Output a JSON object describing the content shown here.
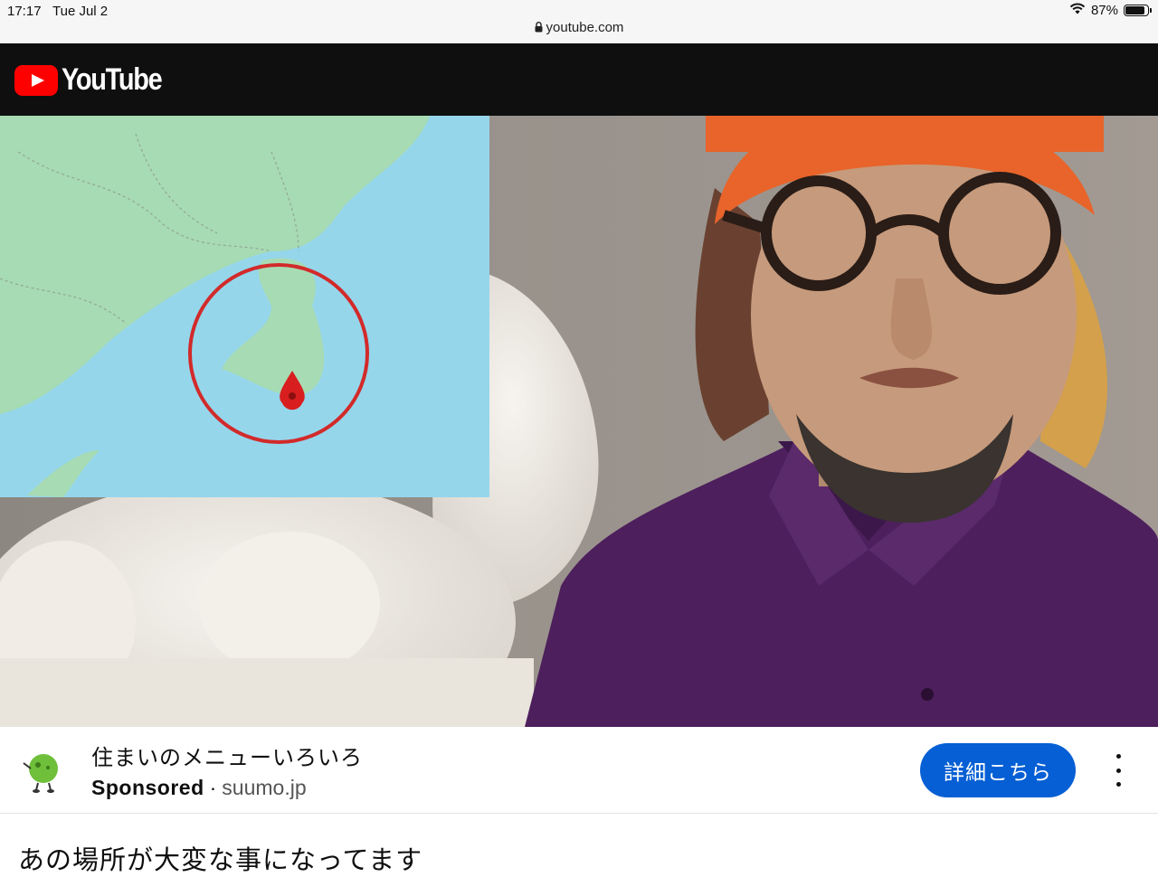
{
  "status_bar": {
    "time": "17:17",
    "date": "Tue Jul 2",
    "battery_percent": "87%",
    "battery_level": 0.87,
    "url": "youtube.com",
    "icons": [
      "wifi-icon",
      "battery-icon",
      "lock-icon"
    ]
  },
  "header": {
    "logo_text": "YouTube",
    "brand_color": "#ff0000",
    "background": "#0f0f0f"
  },
  "video": {
    "map_overlay": {
      "marker_color": "#d81e1e",
      "circle_color": "#d22a2a",
      "water_color": "#95d6eb",
      "land_color": "#a7dbb3"
    }
  },
  "ad": {
    "title": "住まいのメニューいろいろ",
    "sponsored_label": "Sponsored",
    "separator": "·",
    "domain": "suumo.jp",
    "cta_label": "詳細こちら",
    "cta_color": "#065fd4",
    "more_icon": "more-vert-icon"
  },
  "video_title": "あの場所が大変な事になってます"
}
